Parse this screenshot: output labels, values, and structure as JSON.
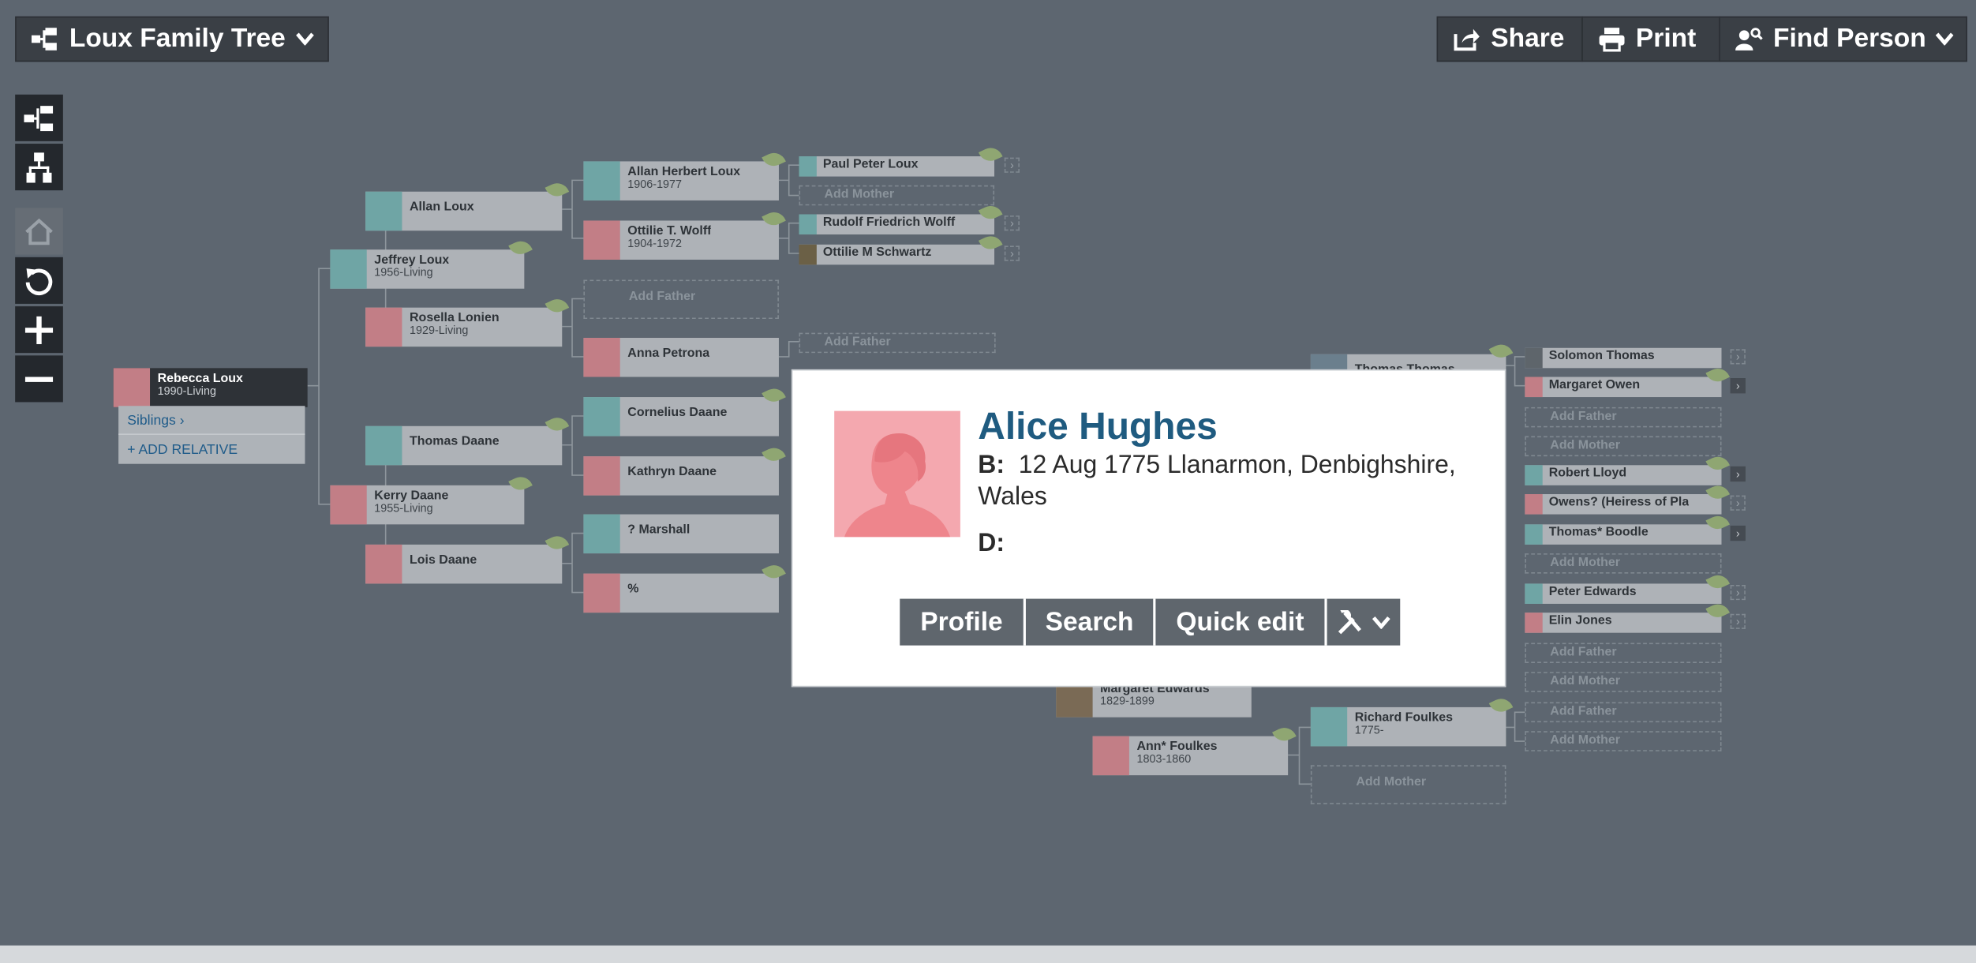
{
  "header": {
    "tree_title": "Loux Family Tree",
    "share_label": "Share",
    "print_label": "Print",
    "find_label": "Find Person"
  },
  "focus": {
    "name": "Rebecca Loux",
    "dates": "1990-Living",
    "siblings_label": "Siblings",
    "add_relative_label": "ADD RELATIVE"
  },
  "people": {
    "jeffrey": {
      "name": "Jeffrey Loux",
      "dates": "1956-Living"
    },
    "kerry": {
      "name": "Kerry Daane",
      "dates": "1955-Living"
    },
    "allan": {
      "name": "Allan Loux"
    },
    "rosella": {
      "name": "Rosella Lonien",
      "dates": "1929-Living"
    },
    "thomas_daane": {
      "name": "Thomas Daane"
    },
    "lois": {
      "name": "Lois Daane"
    },
    "allan_herbert": {
      "name": "Allan Herbert Loux",
      "dates": "1906-1977"
    },
    "ottilie_wolff": {
      "name": "Ottilie T. Wolff",
      "dates": "1904-1972"
    },
    "add_father_1": {
      "name": "Add Father"
    },
    "anna": {
      "name": "Anna Petrona"
    },
    "cornelius": {
      "name": "Cornelius Daane"
    },
    "kathryn": {
      "name": "Kathryn Daane"
    },
    "marshall": {
      "name": "? Marshall"
    },
    "percent": {
      "name": "%"
    },
    "paul": {
      "name": "Paul Peter Loux"
    },
    "add_mother_1": {
      "name": "Add Mother"
    },
    "rudolf": {
      "name": "Rudolf Friedrich Wolff"
    },
    "ottilie_schwartz": {
      "name": "Ottilie M Schwartz"
    },
    "add_father_2": {
      "name": "Add Father"
    },
    "thomas_thomas": {
      "name": "Thomas Thomas"
    },
    "margaret_edwards": {
      "name": "Margaret Edwards",
      "dates": "1829-1899"
    },
    "ann_foulkes": {
      "name": "Ann* Foulkes",
      "dates": "1803-1860"
    },
    "richard_foulkes": {
      "name": "Richard Foulkes",
      "dates": "1775-"
    },
    "add_mother_2": {
      "name": "Add Mother"
    },
    "solomon": {
      "name": "Solomon Thomas"
    },
    "margaret_owen": {
      "name": "Margaret Owen"
    },
    "r_add_father_1": {
      "name": "Add Father"
    },
    "r_add_mother_1": {
      "name": "Add Mother"
    },
    "robert_lloyd": {
      "name": "Robert Lloyd"
    },
    "owens": {
      "name": "Owens? (Heiress of Pla"
    },
    "thomas_boodle": {
      "name": "Thomas* Boodle"
    },
    "r_add_mother_2": {
      "name": "Add Mother"
    },
    "peter_edwards": {
      "name": "Peter Edwards"
    },
    "elin_jones": {
      "name": "Elin Jones"
    },
    "r_add_father_2": {
      "name": "Add Father"
    },
    "r_add_mother_3": {
      "name": "Add Mother"
    },
    "r_add_father_3": {
      "name": "Add Father"
    },
    "r_add_mother_4": {
      "name": "Add Mother"
    }
  },
  "popup": {
    "name": "Alice Hughes",
    "birth_label": "B:",
    "birth_value": "12 Aug 1775 Llanarmon, Denbighshire, Wales",
    "death_label": "D:",
    "actions": [
      "Profile",
      "Search",
      "Quick edit"
    ]
  },
  "colors": {
    "background": "#5d6670",
    "male_photo": "#6fa5a5",
    "female_photo": "#c27e86",
    "popup_name": "#1f5b80",
    "leaf_hint": "#8fa672"
  },
  "icons": {
    "tree": "tree-icon",
    "share": "share-icon",
    "print": "print-icon",
    "find": "find-person-icon",
    "pedigree": "pedigree-view-icon",
    "descendant": "descendant-view-icon",
    "home": "home-icon",
    "reset": "reset-icon",
    "zoom_in": "plus-icon",
    "zoom_out": "minus-icon",
    "tools": "tools-icon"
  }
}
